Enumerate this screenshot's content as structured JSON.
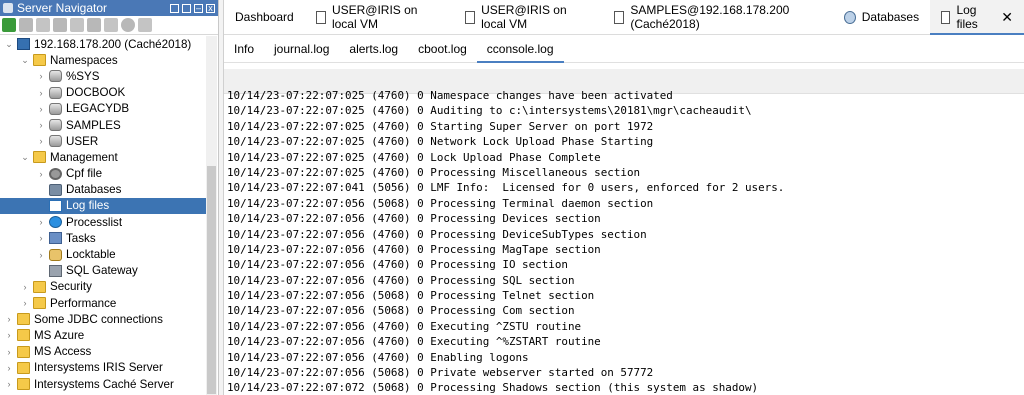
{
  "navigator": {
    "title": "Server Navigator"
  },
  "tree": [
    {
      "label": "192.168.178.200 (Caché2018)",
      "indent": 0,
      "tw": "⌄",
      "icon": "ic-server",
      "iconname": "server-icon"
    },
    {
      "label": "Namespaces",
      "indent": 1,
      "tw": "⌄",
      "icon": "ic-folder",
      "iconname": "folder-icon"
    },
    {
      "label": "%SYS",
      "indent": 2,
      "tw": "›",
      "icon": "ic-db",
      "iconname": "database-icon"
    },
    {
      "label": "DOCBOOK",
      "indent": 2,
      "tw": "›",
      "icon": "ic-db",
      "iconname": "database-icon"
    },
    {
      "label": "LEGACYDB",
      "indent": 2,
      "tw": "›",
      "icon": "ic-db",
      "iconname": "database-icon"
    },
    {
      "label": "SAMPLES",
      "indent": 2,
      "tw": "›",
      "icon": "ic-db",
      "iconname": "database-icon"
    },
    {
      "label": "USER",
      "indent": 2,
      "tw": "›",
      "icon": "ic-db",
      "iconname": "database-icon"
    },
    {
      "label": "Management",
      "indent": 1,
      "tw": "⌄",
      "icon": "ic-folder",
      "iconname": "folder-icon"
    },
    {
      "label": "Cpf file",
      "indent": 2,
      "tw": "›",
      "icon": "ic-gear",
      "iconname": "gear-icon"
    },
    {
      "label": "Databases",
      "indent": 2,
      "tw": "",
      "icon": "ic-dbs",
      "iconname": "databases-icon"
    },
    {
      "label": "Log files",
      "indent": 2,
      "tw": "",
      "icon": "ic-log",
      "iconname": "log-file-icon",
      "selected": true
    },
    {
      "label": "Processlist",
      "indent": 2,
      "tw": "›",
      "icon": "ic-proc",
      "iconname": "process-icon"
    },
    {
      "label": "Tasks",
      "indent": 2,
      "tw": "›",
      "icon": "ic-task",
      "iconname": "tasks-icon"
    },
    {
      "label": "Locktable",
      "indent": 2,
      "tw": "›",
      "icon": "ic-lock",
      "iconname": "lock-icon"
    },
    {
      "label": "SQL Gateway",
      "indent": 2,
      "tw": "",
      "icon": "ic-sqlg",
      "iconname": "sql-gateway-icon"
    },
    {
      "label": "Security",
      "indent": 1,
      "tw": "›",
      "icon": "ic-folder",
      "iconname": "folder-icon"
    },
    {
      "label": "Performance",
      "indent": 1,
      "tw": "›",
      "icon": "ic-folder",
      "iconname": "folder-icon"
    },
    {
      "label": "Some JDBC connections",
      "indent": 0,
      "tw": "›",
      "icon": "ic-folder",
      "iconname": "folder-icon"
    },
    {
      "label": "MS Azure",
      "indent": 0,
      "tw": "›",
      "icon": "ic-folder",
      "iconname": "folder-icon"
    },
    {
      "label": "MS Access",
      "indent": 0,
      "tw": "›",
      "icon": "ic-folder",
      "iconname": "folder-icon"
    },
    {
      "label": "Intersystems IRIS Server",
      "indent": 0,
      "tw": "›",
      "icon": "ic-folder",
      "iconname": "folder-icon"
    },
    {
      "label": "Intersystems Caché Server",
      "indent": 0,
      "tw": "›",
      "icon": "ic-folder",
      "iconname": "folder-icon"
    }
  ],
  "tabs": [
    {
      "label": "Dashboard",
      "icon": ""
    },
    {
      "label": "USER@IRIS on local VM",
      "icon": "doc"
    },
    {
      "label": "USER@IRIS on local VM",
      "icon": "doc"
    },
    {
      "label": "SAMPLES@192.168.178.200 (Caché2018)",
      "icon": "doc"
    },
    {
      "label": "Databases",
      "icon": "db"
    },
    {
      "label": "Log files",
      "icon": "doc",
      "active": true,
      "close": "✕"
    }
  ],
  "subtabs": [
    {
      "label": "Info"
    },
    {
      "label": "journal.log"
    },
    {
      "label": "alerts.log"
    },
    {
      "label": "cboot.log"
    },
    {
      "label": "cconsole.log",
      "active": true
    }
  ],
  "log_lines": [
    "10/14/23-07:22:07:025 (4760) 0 Namespace changes have been activated",
    "10/14/23-07:22:07:025 (4760) 0 Auditing to c:\\intersystems\\20181\\mgr\\cacheaudit\\",
    "10/14/23-07:22:07:025 (4760) 0 Starting Super Server on port 1972",
    "10/14/23-07:22:07:025 (4760) 0 Network Lock Upload Phase Starting",
    "10/14/23-07:22:07:025 (4760) 0 Lock Upload Phase Complete",
    "10/14/23-07:22:07:025 (4760) 0 Processing Miscellaneous section",
    "10/14/23-07:22:07:041 (5056) 0 LMF Info:  Licensed for 0 users, enforced for 2 users.",
    "10/14/23-07:22:07:056 (5068) 0 Processing Terminal daemon section",
    "10/14/23-07:22:07:056 (4760) 0 Processing Devices section",
    "10/14/23-07:22:07:056 (4760) 0 Processing DeviceSubTypes section",
    "10/14/23-07:22:07:056 (4760) 0 Processing MagTape section",
    "10/14/23-07:22:07:056 (4760) 0 Processing IO section",
    "10/14/23-07:22:07:056 (4760) 0 Processing SQL section",
    "10/14/23-07:22:07:056 (5068) 0 Processing Telnet section",
    "10/14/23-07:22:07:056 (5068) 0 Processing Com section",
    "10/14/23-07:22:07:056 (4760) 0 Executing ^ZSTU routine",
    "10/14/23-07:22:07:056 (4760) 0 Executing ^%ZSTART routine",
    "10/14/23-07:22:07:056 (4760) 0 Enabling logons",
    "10/14/23-07:22:07:056 (5068) 0 Private webserver started on 57772",
    "10/14/23-07:22:07:072 (5068) 0 Processing Shadows section (this system as shadow)"
  ]
}
